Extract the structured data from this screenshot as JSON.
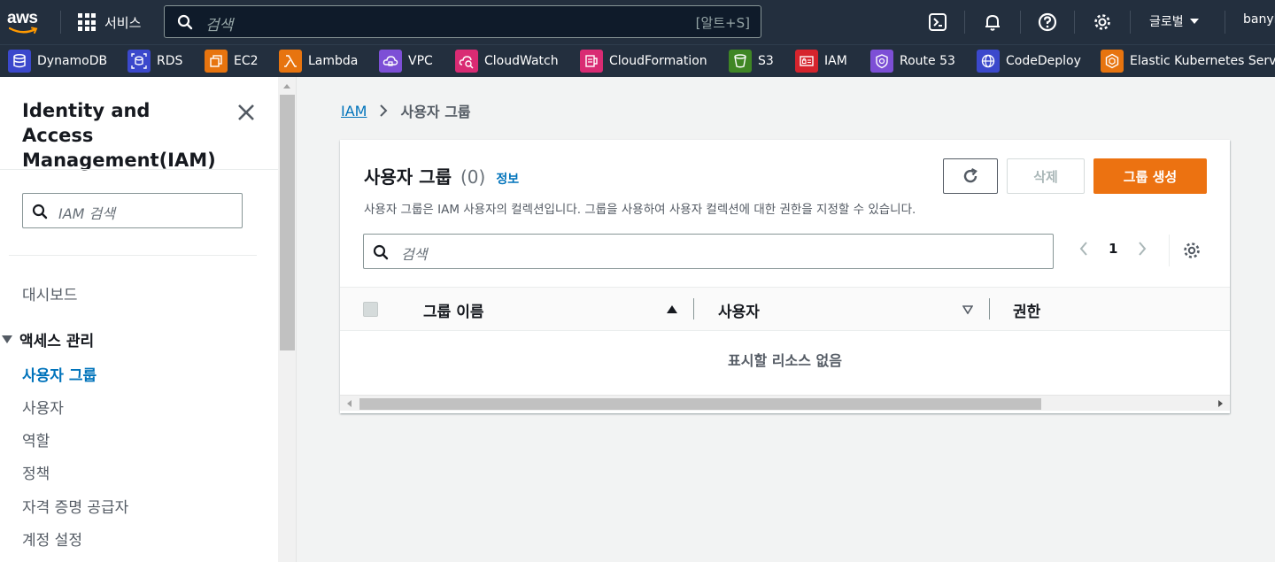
{
  "topnav": {
    "logo_text": "aws",
    "services_label": "서비스",
    "search_placeholder": "검색",
    "search_shortcut": "[알트+S]",
    "icons": [
      "cloudshell-icon",
      "bell-icon",
      "help-icon",
      "gear-icon"
    ],
    "region": "글로벌",
    "user": "banyl"
  },
  "favorites": [
    {
      "label": "DynamoDB",
      "color": "#3b48cc"
    },
    {
      "label": "RDS",
      "color": "#3b48cc"
    },
    {
      "label": "EC2",
      "color": "#e7740f"
    },
    {
      "label": "Lambda",
      "color": "#e7740f"
    },
    {
      "label": "VPC",
      "color": "#7d4fd6"
    },
    {
      "label": "CloudWatch",
      "color": "#d92b73"
    },
    {
      "label": "CloudFormation",
      "color": "#d92b73"
    },
    {
      "label": "S3",
      "color": "#3f8624"
    },
    {
      "label": "IAM",
      "color": "#d6242d"
    },
    {
      "label": "Route 53",
      "color": "#7d4fd6"
    },
    {
      "label": "CodeDeploy",
      "color": "#3b48cc"
    },
    {
      "label": "Elastic Kubernetes Servi",
      "color": "#e7740f"
    }
  ],
  "sidebar": {
    "title": "Identity and Access Management(IAM)",
    "search_placeholder": "IAM 검색",
    "dashboard": "대시보드",
    "section": "액세스 관리",
    "items": [
      {
        "label": "사용자 그룹",
        "active": true
      },
      {
        "label": "사용자",
        "active": false
      },
      {
        "label": "역할",
        "active": false
      },
      {
        "label": "정책",
        "active": false
      },
      {
        "label": "자격 증명 공급자",
        "active": false
      },
      {
        "label": "계정 설정",
        "active": false
      }
    ]
  },
  "breadcrumb": {
    "root": "IAM",
    "current": "사용자 그룹"
  },
  "panel": {
    "title": "사용자 그룹",
    "count": "(0)",
    "info": "정보",
    "description": "사용자 그룹은 IAM 사용자의 컬렉션입니다. 그룹을 사용하여 사용자 컬렉션에 대한 권한을 지정할 수 있습니다.",
    "delete_label": "삭제",
    "create_label": "그룹 생성",
    "search_placeholder": "검색",
    "page": "1",
    "columns": [
      "그룹 이름",
      "사용자",
      "권한"
    ],
    "empty_text": "표시할 리소스 없음"
  },
  "colors": {
    "nav_bg": "#232f3e",
    "accent": "#ec7211",
    "link": "#0073bb"
  }
}
